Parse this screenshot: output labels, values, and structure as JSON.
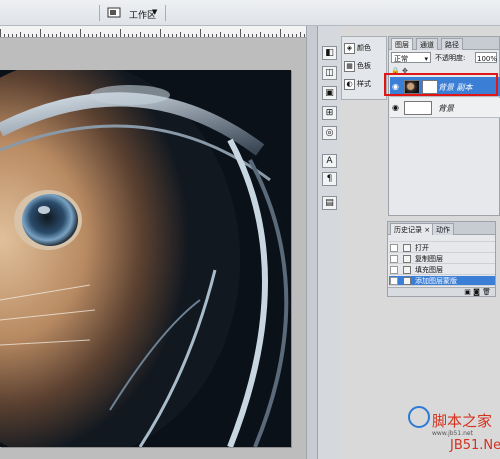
{
  "toolbar": {
    "workspace_label": "工作区"
  },
  "dock": {
    "items": [
      {
        "label": "颜色"
      },
      {
        "label": "色板"
      },
      {
        "label": "样式"
      }
    ]
  },
  "layers_panel": {
    "tabs": [
      "图层",
      "通道",
      "路径"
    ],
    "blend_mode": "正常",
    "opacity_label": "不透明度:",
    "opacity_value": "100%",
    "layers": [
      {
        "name": "背景 副本",
        "selected": true
      },
      {
        "name": "背景",
        "selected": false
      }
    ]
  },
  "history_panel": {
    "tabs": [
      "历史记录",
      "动作"
    ],
    "items": [
      {
        "label": "打开",
        "selected": false
      },
      {
        "label": "复制图层",
        "selected": false
      },
      {
        "label": "填充图层",
        "selected": false
      },
      {
        "label": "添加图层蒙版",
        "selected": true
      }
    ]
  },
  "watermark": {
    "title": "脚本之家",
    "subtitle": "www.jb51.net",
    "brand": "JB51.Net"
  },
  "colors": {
    "selection": "#3b7ed6",
    "highlight": "#e01515",
    "watermark_red": "#d3321f"
  }
}
